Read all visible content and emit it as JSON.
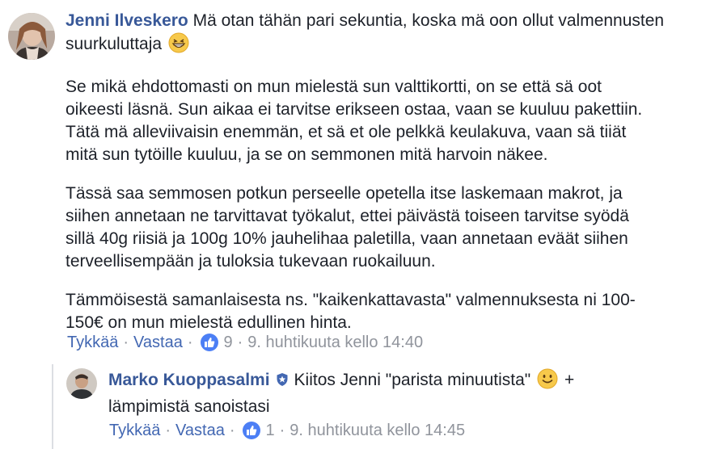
{
  "comment": {
    "avatar_icon": "jenni-avatar",
    "author": "Jenni Ilveskero",
    "intro_text": "Mä otan tähän pari sekuntia, koska mä oon ollut valmennusten suurkuluttaja",
    "intro_emoji": "grinning-face-icon",
    "paragraphs": [
      "Se mikä ehdottomasti on mun mielestä sun valttikortti, on se että sä oot\noikeesti läsnä. Sun aikaa ei tarvitse erikseen ostaa, vaan se kuuluu pakettiin.\nTätä mä alleviivaisin enemmän, et sä et ole pelkkä keulakuva, vaan sä tiiät\nmitä sun tytöille kuuluu, ja se on semmonen mitä harvoin näkee.",
      "Tässä saa semmosen potkun perseelle opetella itse laskemaan makrot, ja\nsiihen annetaan ne tarvittavat työkalut, ettei päivästä toiseen tarvitse syödä\nsillä 40g riisiä ja 100g 10% jauhelihaa paletilla, vaan annetaan eväät siihen\nterveellisempään ja tuloksia tukevaan ruokailuun.",
      "Tämmöisestä samanlaisesta ns. \"kaikenkattavasta\" valmennuksesta ni 100-\n150€ on mun mielestä edullinen hinta."
    ],
    "actions": {
      "like": "Tykkää",
      "reply": "Vastaa",
      "like_count": "9",
      "timestamp": "9. huhtikuuta kello 14:40"
    }
  },
  "reply": {
    "avatar_icon": "marko-avatar",
    "author": "Marko Kuoppasalmi",
    "verified_icon": "verified-badge-icon",
    "text_before_emoji": "Kiitos Jenni \"parista minuutista\"",
    "emoji": "slightly-smiling-face-icon",
    "text_after_emoji": "+",
    "text_line2": "lämpimistä sanoistasi",
    "actions": {
      "like": "Tykkää",
      "reply": "Vastaa",
      "like_count": "1",
      "timestamp": "9. huhtikuuta kello 14:45"
    }
  },
  "colors": {
    "author_link": "#385898",
    "action_link": "#4267b2",
    "meta_text": "#90949c",
    "like_badge": "#4c7ff5",
    "thread_line": "#dcdee3"
  }
}
